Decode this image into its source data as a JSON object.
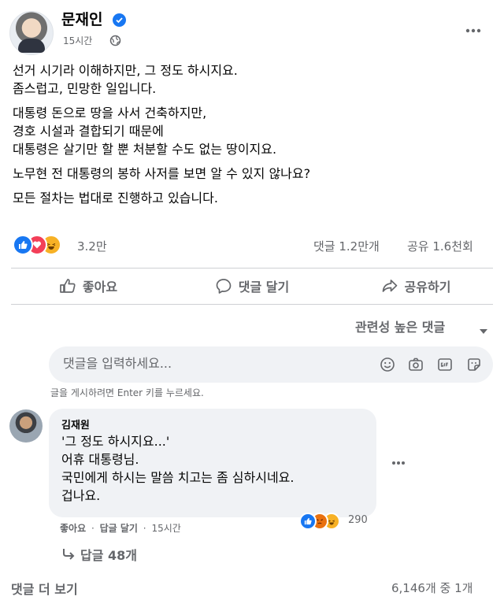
{
  "post": {
    "author": "문재인",
    "time": "15시간",
    "paragraphs": [
      "선거 시기라 이해하지만, 그 정도 하시지요.\n좀스럽고, 민망한 일입니다.",
      "대통령 돈으로 땅을 사서 건축하지만,\n경호 시설과 결합되기 때문에\n대통령은 살기만 할 뿐 처분할 수도 없는 땅이지요.",
      "노무현 전 대통령의 봉하 사저를 보면 알 수 있지 않나요?",
      "모든 절차는 법대로 진행하고 있습니다."
    ]
  },
  "stats": {
    "reactions": "3.2만",
    "comments": "댓글 1.2만개",
    "shares": "공유 1.6천회"
  },
  "actions": {
    "like": "좋아요",
    "comment": "댓글 달기",
    "share": "공유하기"
  },
  "sort_label": "관련성 높은 댓글",
  "composer": {
    "placeholder": "댓글을 입력하세요...",
    "hint": "글을 게시하려면 Enter 키를 누르세요."
  },
  "comment": {
    "author": "김재원",
    "lines": [
      "'그 정도 하시지요...'",
      "어휴 대통령님.",
      "국민에게 하시는 말씀 치고는 좀 심하시네요.",
      "겁나요."
    ],
    "reaction_count": "290",
    "like_label": "좋아요",
    "reply_label": "답글 달기",
    "time": "15시간",
    "replies_label": "답글 48개"
  },
  "more_comments_label": "댓글 더 보기",
  "comment_pager": "6,146개 중 1개",
  "colors": {
    "accent": "#1877f2",
    "muted_text": "#65676b",
    "bubble": "#f0f2f5",
    "love": "#f33e58",
    "haha": "#f7b125"
  },
  "icons": [
    "verified-icon",
    "globe-icon",
    "more-icon",
    "like-icon",
    "comment-icon",
    "share-icon",
    "caret-down-icon",
    "emoji-icon",
    "camera-icon",
    "gif-icon",
    "sticker-icon",
    "reply-arrow-icon"
  ]
}
